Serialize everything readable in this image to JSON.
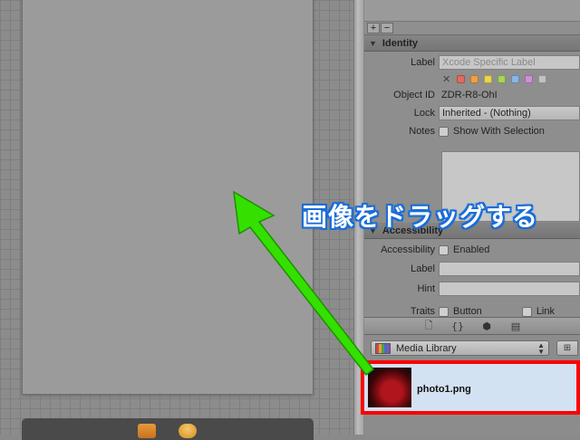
{
  "inspector": {
    "add_label": "+",
    "remove_label": "−",
    "identity_header": "Identity",
    "label_label": "Label",
    "label_placeholder": "Xcode Specific Label",
    "clear_color_label": "✕",
    "label_colors": [
      "#e06b5f",
      "#ef9f4a",
      "#e9d44f",
      "#a4d45a",
      "#8ab6e6",
      "#cf8fd9",
      "#c2c2c2"
    ],
    "object_id_label": "Object ID",
    "object_id_value": "ZDR-R8-OhI",
    "lock_label": "Lock",
    "lock_value": "Inherited - (Nothing)",
    "notes_label": "Notes",
    "notes_checkbox_label": "Show With Selection",
    "accessibility_header": "Accessibility",
    "accessibility_label": "Accessibility",
    "accessibility_checkbox_label": "Enabled",
    "acc_label_label": "Label",
    "hint_label": "Hint",
    "traits_label": "Traits",
    "traits_button_label": "Button",
    "traits_link_label": "Link"
  },
  "library": {
    "tab_icons": [
      "file-template-icon",
      "code-snippet-icon",
      "object-library-icon",
      "media-library-icon"
    ],
    "tab_glyphs": [
      "🗋",
      "{}",
      "⬢",
      "▤"
    ],
    "selected_library": "Media Library",
    "view_toggle_glyph": "⊞",
    "media_item_name": "photo1.png"
  },
  "annotation": {
    "callout": "画像をドラッグする",
    "arrow_color": "#33e000",
    "highlight_color": "#ff0000",
    "callout_color": "#ffffff",
    "callout_outline": "#1a6ed8"
  }
}
